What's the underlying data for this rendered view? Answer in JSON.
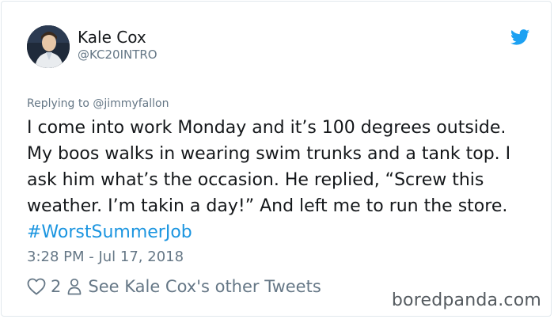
{
  "user": {
    "display_name": "Kale Cox",
    "handle": "@KC20INTRO"
  },
  "reply": {
    "prefix": "Replying to ",
    "mention": "@jimmyfallon"
  },
  "tweet": {
    "text": "I come into work Monday and it’s 100 degrees outside. My boos walks in wearing swim trunks and a tank top. I ask him what’s the occasion. He replied, “Screw this weather. I’m takin a day!” And left me to run the store. ",
    "hashtag": "#WorstSummerJob",
    "timestamp": "3:28 PM - Jul 17, 2018"
  },
  "actions": {
    "likes": "2",
    "other_tweets_label": "See Kale Cox's other Tweets"
  },
  "icons": {
    "twitter_bird": "twitter-bird-icon",
    "like": "heart-icon",
    "profile": "person-icon"
  },
  "colors": {
    "text": "#14171a",
    "secondary": "#657786",
    "link": "#1b95e0",
    "twitter_blue": "#1da1f2"
  },
  "watermark": "boredpanda.com"
}
